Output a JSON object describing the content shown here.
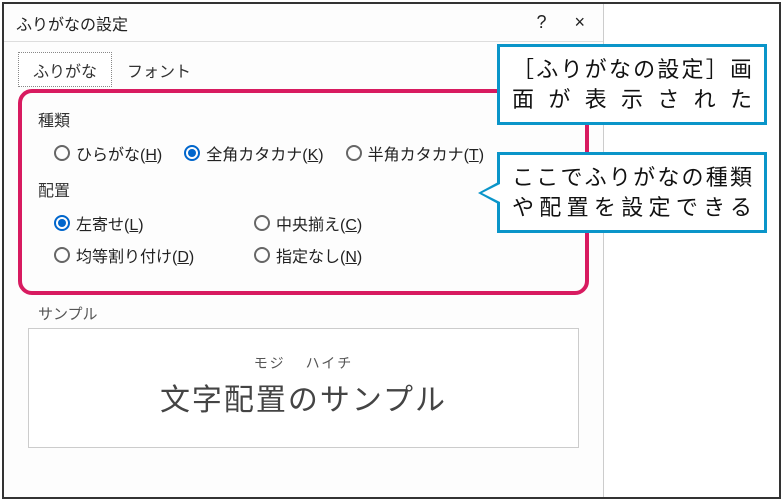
{
  "dialog": {
    "title": "ふりがなの設定",
    "help": "?",
    "close": "×",
    "tabs": {
      "furigana": "ふりがな",
      "font": "フォント"
    }
  },
  "groups": {
    "type": {
      "label": "種類",
      "options": {
        "hiragana": {
          "text": "ひらがな(",
          "key": "H",
          "tail": ")"
        },
        "zenkaku": {
          "text": "全角カタカナ(",
          "key": "K",
          "tail": ")"
        },
        "hankaku": {
          "text": "半角カタカナ(",
          "key": "T",
          "tail": ")"
        }
      }
    },
    "align": {
      "label": "配置",
      "options": {
        "left": {
          "text": "左寄せ(",
          "key": "L",
          "tail": ")"
        },
        "center": {
          "text": "中央揃え(",
          "key": "C",
          "tail": ")"
        },
        "dist": {
          "text": "均等割り付け(",
          "key": "D",
          "tail": ")"
        },
        "none": {
          "text": "指定なし(",
          "key": "N",
          "tail": ")"
        }
      }
    }
  },
  "sample": {
    "label": "サンプル",
    "ruby1": "モジ",
    "ruby2": "ハイチ",
    "text": "文字配置のサンプル"
  },
  "callouts": {
    "c1": "［ふりがなの設定］画面が表示された",
    "c2": "ここでふりがなの種類や配置を設定できる"
  }
}
